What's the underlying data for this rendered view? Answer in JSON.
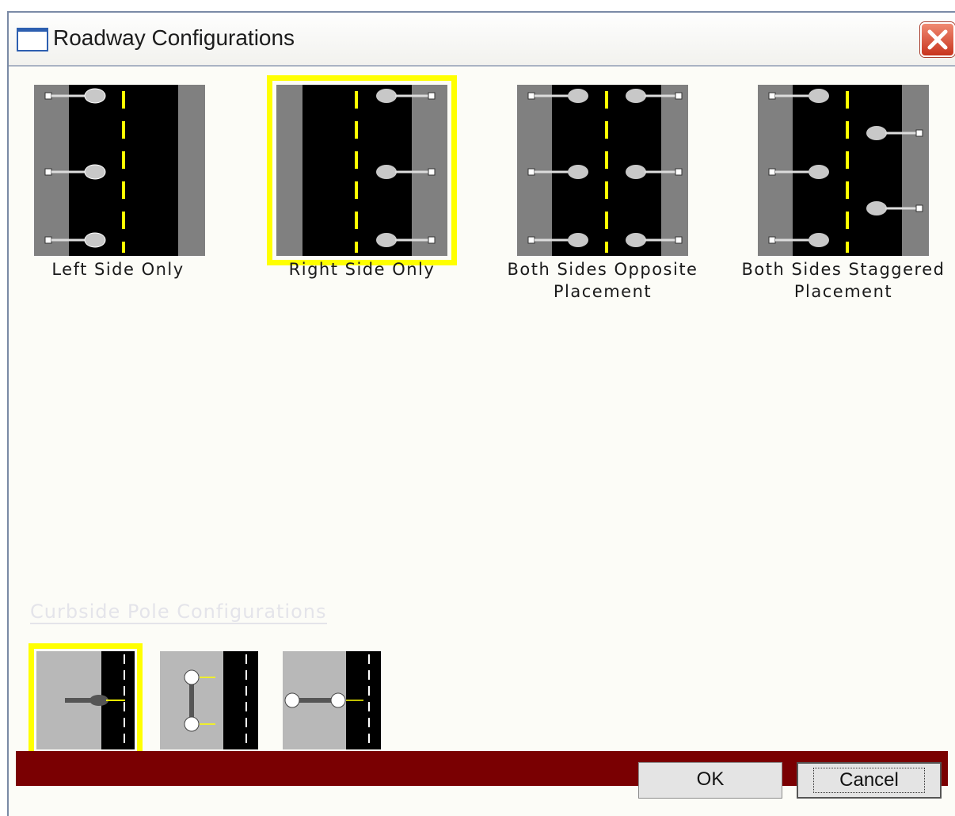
{
  "window": {
    "title": "Roadway Configurations"
  },
  "roadway_configurations": [
    {
      "label": "Left Side Only",
      "selected": false
    },
    {
      "label": "Right Side Only",
      "selected": true
    },
    {
      "label": "Both Sides Opposite Placement",
      "selected": false
    },
    {
      "label": "Both Sides Staggered Placement",
      "selected": false
    }
  ],
  "curbside": {
    "label": "Curbside Pole Configurations",
    "selected_index": 0
  },
  "buttons": {
    "ok": "OK",
    "cancel": "Cancel"
  },
  "colors": {
    "selection": "#ffff00",
    "footer": "#7a0002",
    "road": "#000000",
    "shoulder": "#808080",
    "lane_marking": "#ffff00"
  }
}
